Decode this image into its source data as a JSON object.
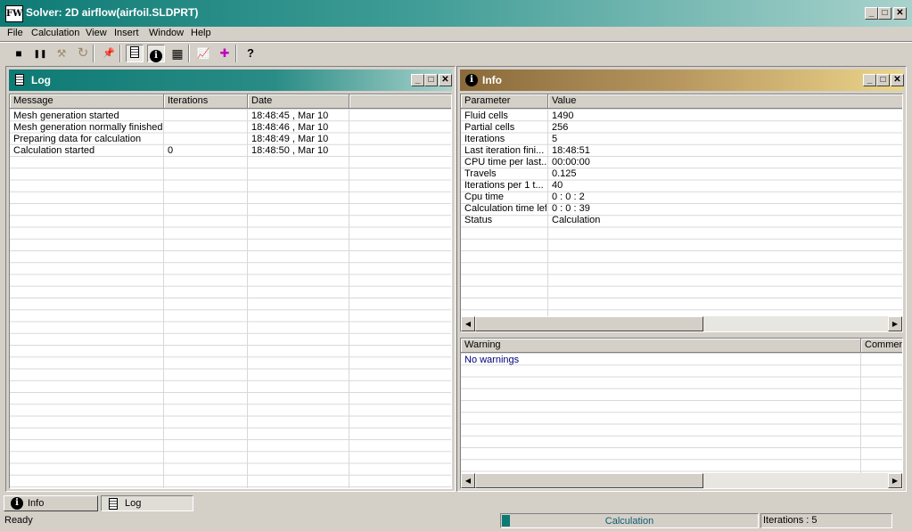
{
  "window": {
    "title": "Solver: 2D airflow(airfoil.SLDPRT)",
    "app_icon_text": "FW"
  },
  "menu": [
    "File",
    "Calculation",
    "View",
    "Insert",
    "Window",
    "Help"
  ],
  "toolbar": [
    {
      "icon": "stop-icon",
      "glyph": "■"
    },
    {
      "icon": "pause-icon",
      "glyph": "❚❚"
    },
    {
      "icon": "step-icon",
      "glyph": "⚒"
    },
    {
      "icon": "refresh-icon",
      "glyph": "↻"
    },
    {
      "icon": "pin-icon",
      "glyph": "📌"
    },
    {
      "icon": "log-icon",
      "glyph": "▤"
    },
    {
      "icon": "info-icon",
      "glyph": "i"
    },
    {
      "icon": "goals-icon",
      "glyph": "▦"
    },
    {
      "icon": "plot-icon",
      "glyph": "📈"
    },
    {
      "icon": "preview-icon",
      "glyph": "✚"
    },
    {
      "icon": "help-icon",
      "glyph": "?"
    }
  ],
  "log": {
    "title": "Log",
    "columns": [
      "Message",
      "Iterations",
      "Date"
    ],
    "rows": [
      {
        "message": "Mesh generation started",
        "iterations": "",
        "date": "18:48:45 , Mar 10"
      },
      {
        "message": "Mesh generation normally finished",
        "iterations": "",
        "date": "18:48:46 , Mar 10"
      },
      {
        "message": "Preparing data for calculation",
        "iterations": "",
        "date": "18:48:49 , Mar 10"
      },
      {
        "message": "Calculation started",
        "iterations": "0",
        "date": "18:48:50 , Mar 10"
      }
    ]
  },
  "info": {
    "title": "Info",
    "columns": [
      "Parameter",
      "Value"
    ],
    "rows": [
      {
        "parameter": "Fluid cells",
        "value": "1490"
      },
      {
        "parameter": "Partial cells",
        "value": "256"
      },
      {
        "parameter": "Iterations",
        "value": "5"
      },
      {
        "parameter": "Last iteration fini...",
        "value": "18:48:51"
      },
      {
        "parameter": "CPU time per last...",
        "value": "00:00:00"
      },
      {
        "parameter": "Travels",
        "value": "0.125"
      },
      {
        "parameter": "Iterations per 1 t...",
        "value": "40"
      },
      {
        "parameter": "Cpu time",
        "value": "0 : 0 : 2"
      },
      {
        "parameter": "Calculation time left",
        "value": "0 : 0 : 39"
      },
      {
        "parameter": "Status",
        "value": "Calculation"
      }
    ],
    "warning_columns": [
      "Warning",
      "Comment"
    ],
    "warnings": [
      "No warnings"
    ]
  },
  "tabs": [
    "Info",
    "Log"
  ],
  "status": {
    "ready": "Ready",
    "progress_label": "Calculation",
    "progress_fraction": 0.03,
    "iterations": "Iterations : 5"
  },
  "colors": {
    "log_title": "#0e7a74",
    "info_title": "#8a6a3a",
    "warning_text": "#000080"
  }
}
